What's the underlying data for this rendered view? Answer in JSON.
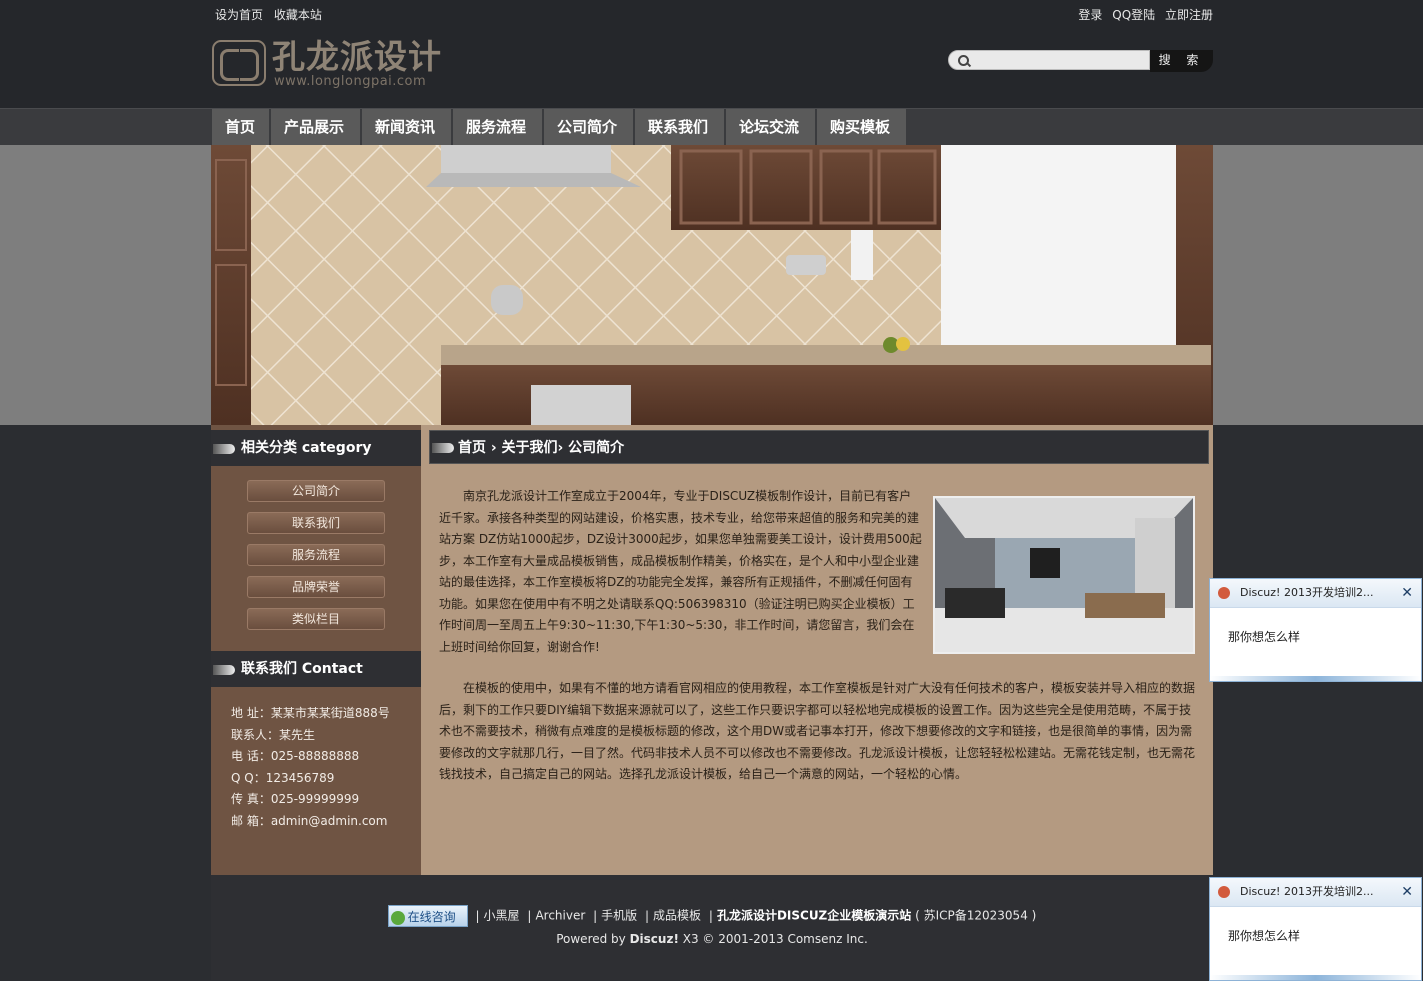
{
  "top": {
    "left_links": [
      "设为首页",
      "收藏本站"
    ],
    "right_links": [
      "登录",
      "QQ登陆",
      "立即注册"
    ]
  },
  "logo": {
    "title": "孔龙派设计",
    "url_text": "www.longlongpai.com"
  },
  "search": {
    "button": "搜 索",
    "placeholder": "",
    "icon": "search-icon"
  },
  "nav": [
    "首页",
    "产品展示",
    "新闻资讯",
    "服务流程",
    "公司简介",
    "联系我们",
    "论坛交流",
    "购买模板"
  ],
  "sidebar": {
    "category_title": "相关分类 category",
    "categories": [
      "公司简介",
      "联系我们",
      "服务流程",
      "品牌荣誉",
      "类似栏目"
    ],
    "contact_title": "联系我们 Contact",
    "contact_lines": [
      "地  址：某某市某某街道888号",
      "联系人：某先生",
      "电  话：025-88888888",
      "Q  Q：123456789",
      "传  真：025-99999999",
      "邮  箱：admin@admin.com"
    ]
  },
  "main": {
    "breadcrumb": "首页 › 关于我们› 公司简介",
    "paragraph1": "南京孔龙派设计工作室成立于2004年，专业于DISCUZ模板制作设计，目前已有客户近千家。承接各种类型的网站建设，价格实惠，技术专业，给您带来超值的服务和完美的建站方案 DZ仿站1000起步，DZ设计3000起步，如果您单独需要美工设计，设计费用500起步，本工作室有大量成品模板销售，成品模板制作精美，价格实在，是个人和中小型企业建站的最佳选择，本工作室模板将DZ的功能完全发挥，兼容所有正规插件，不删减任何固有功能。如果您在使用中有不明之处请联系QQ:506398310（验证注明已购买企业模板）工作时间周一至周五上午9:30~11:30,下午1:30~5:30，非工作时间，请您留言，我们会在上班时间给你回复，谢谢合作!",
    "paragraph2": "在模板的使用中，如果有不懂的地方请看官网相应的使用教程，本工作室模板是针对广大没有任何技术的客户，模板安装并导入相应的数据后，剩下的工作只要DIY编辑下数据来源就可以了，这些工作只要识字都可以轻松地完成模板的设置工作。因为这些完全是使用范畴，不属于技术也不需要技术，稍微有点难度的是模板标题的修改，这个用DW或者记事本打开，修改下想要修改的文字和链接，也是很简单的事情，因为需要修改的文字就那几行，一目了然。代码非技术人员不可以修改也不需要修改。孔龙派设计模板，让您轻轻松松建站。无需花钱定制，也无需花钱找技术，自己搞定自己的网站。选择孔龙派设计模板，给自己一个满意的网站，一个轻松的心情。"
  },
  "footer": {
    "consult": "在线咨询",
    "links": [
      "小黑屋",
      "Archiver",
      "手机版",
      "成品模板"
    ],
    "site_name": "孔龙派设计DISCUZ企业模板演示站",
    "icp": "( 苏ICP备12023054 )",
    "powered_prefix": "Powered by ",
    "powered_brand": "Discuz!",
    "powered_rest": " X3 © 2001-2013 Comsenz Inc."
  },
  "popups": [
    {
      "title": "Discuz! 2013开发培训2...",
      "message": "那你想怎么样",
      "close": "✕"
    },
    {
      "title": "Discuz! 2013开发培训2...",
      "message": "那你想怎么样",
      "close": "✕"
    }
  ],
  "colors": {
    "page_bg": "#2b2d31",
    "nav_item": "#5a5a5a",
    "sidebar_bg": "#6f5443",
    "content_bg": "#b49a81"
  }
}
